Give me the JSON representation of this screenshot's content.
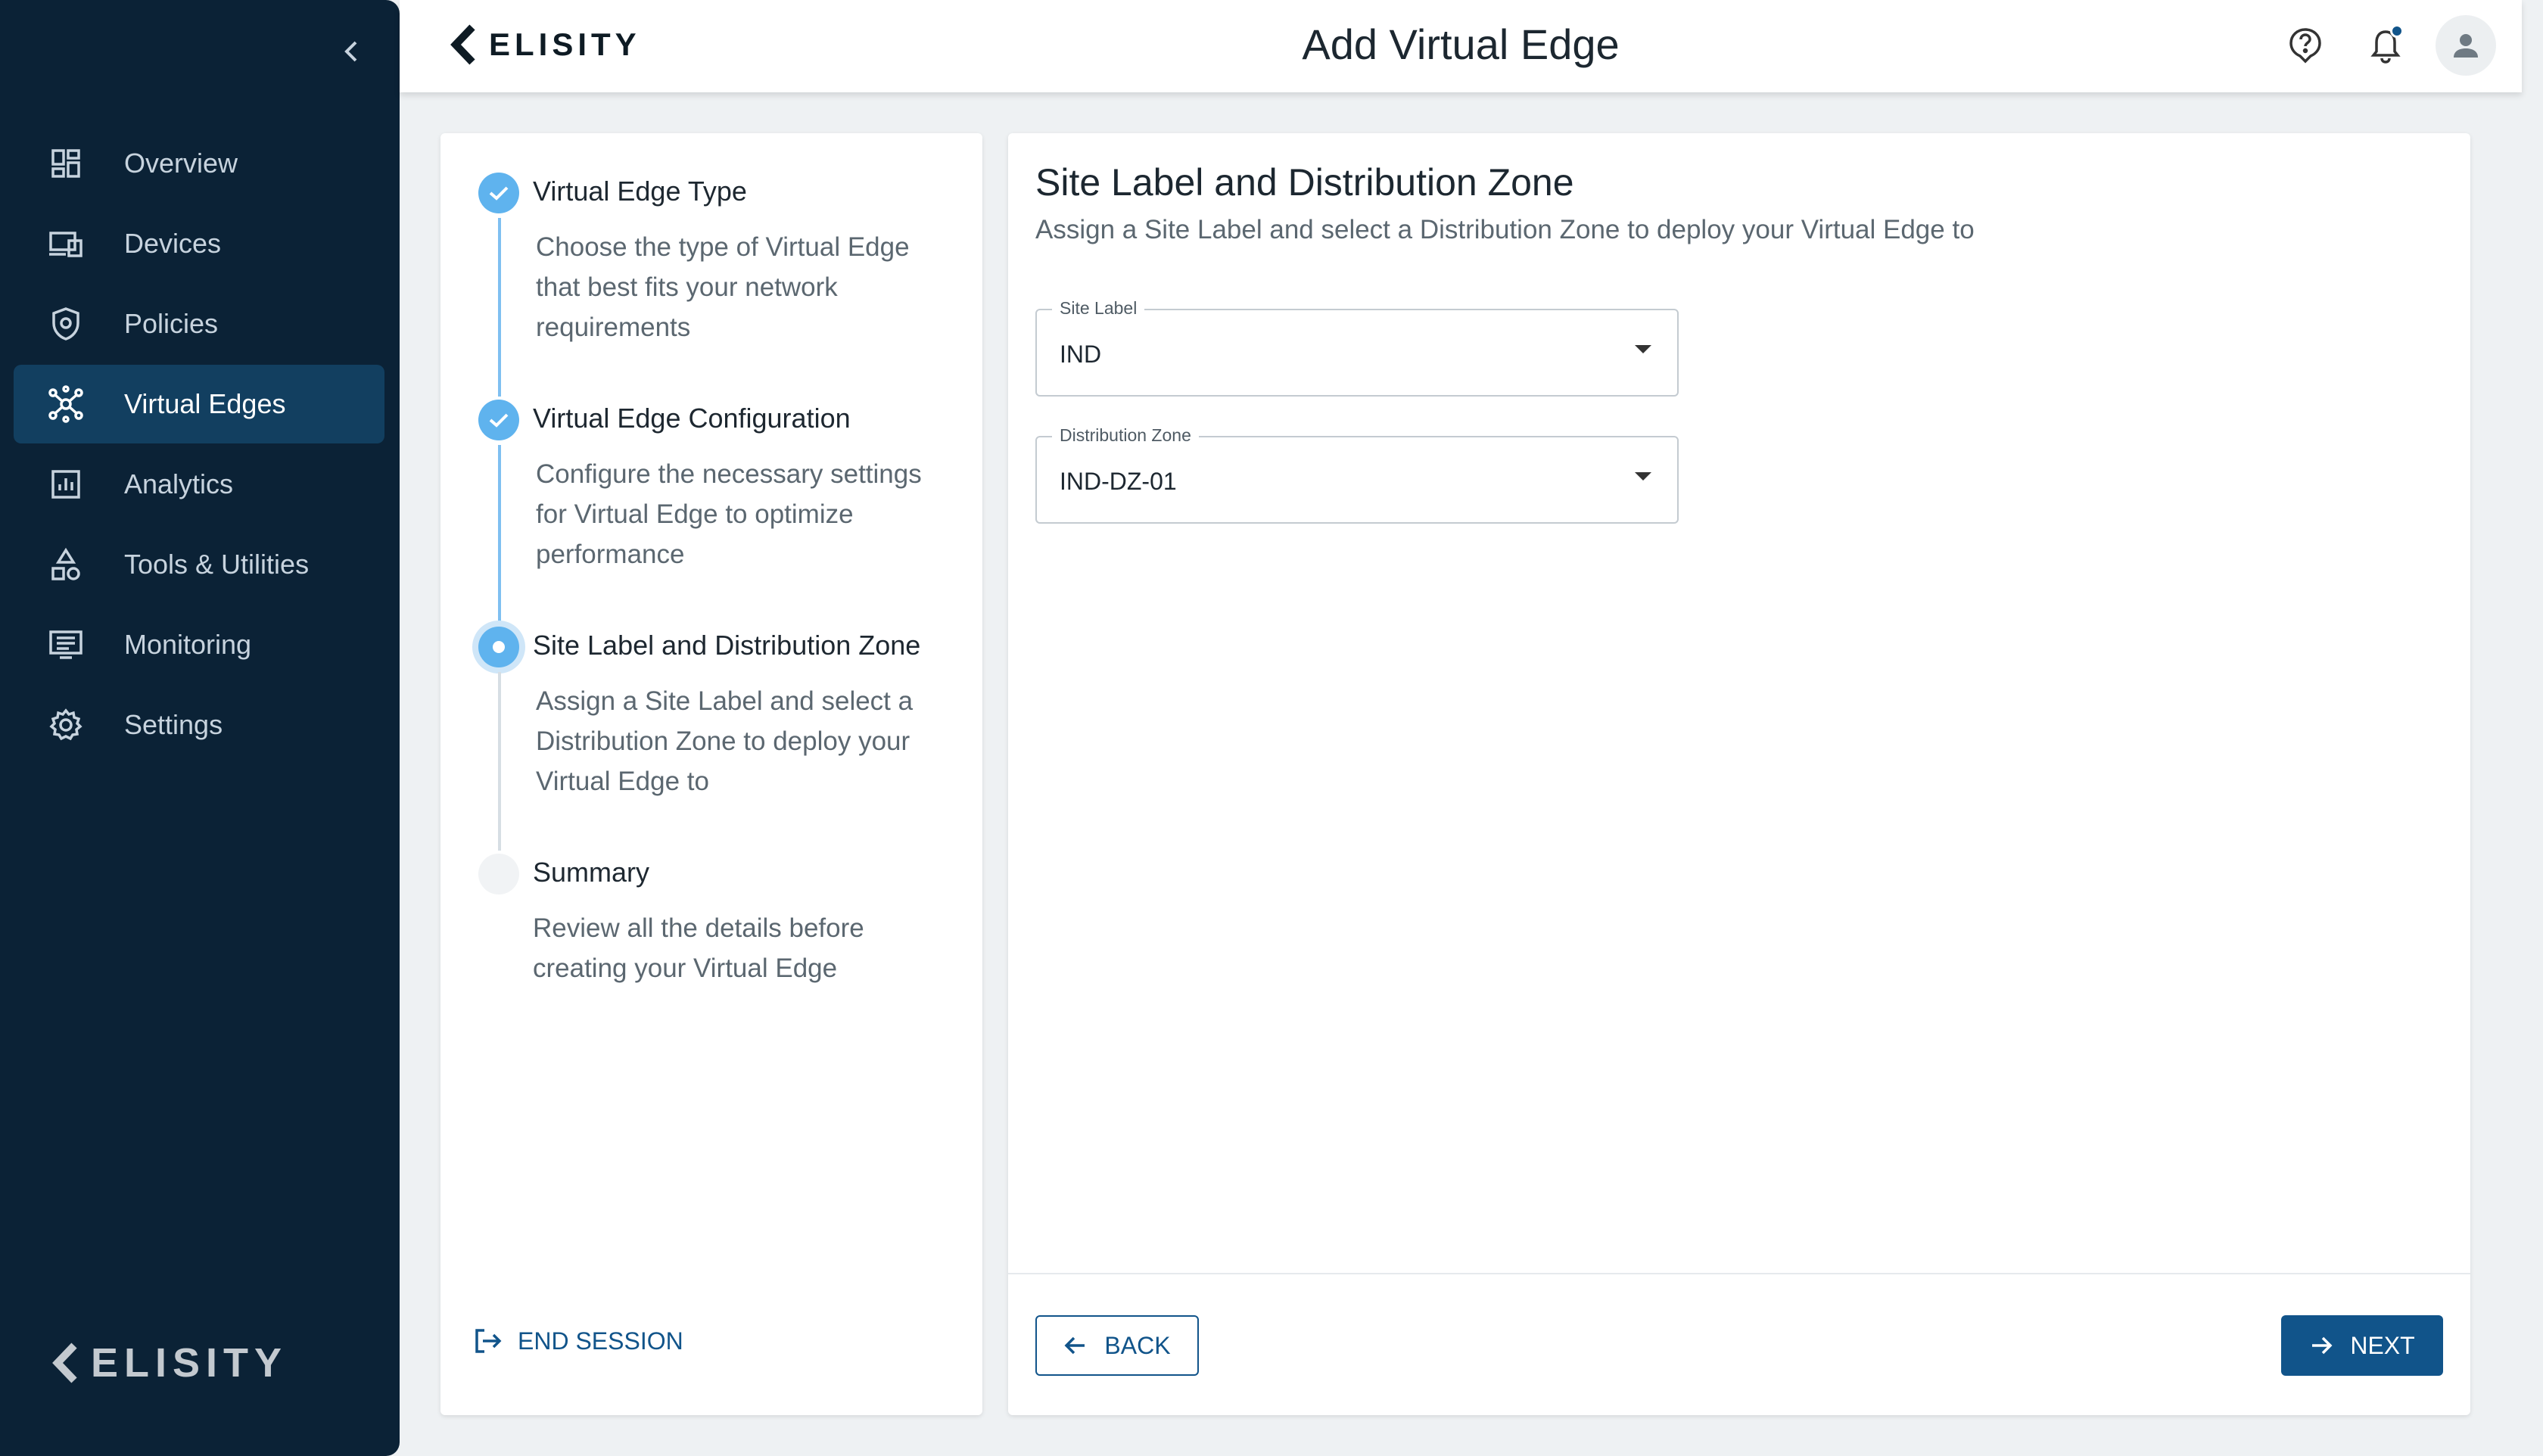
{
  "app": {
    "brand": "ELISITY",
    "page_title": "Add Virtual Edge"
  },
  "sidebar": {
    "items": [
      {
        "label": "Overview",
        "icon": "dashboard-icon"
      },
      {
        "label": "Devices",
        "icon": "devices-icon"
      },
      {
        "label": "Policies",
        "icon": "shield-icon"
      },
      {
        "label": "Virtual Edges",
        "icon": "hub-icon",
        "active": true
      },
      {
        "label": "Analytics",
        "icon": "analytics-icon"
      },
      {
        "label": "Tools & Utilities",
        "icon": "tools-icon"
      },
      {
        "label": "Monitoring",
        "icon": "monitor-icon"
      },
      {
        "label": "Settings",
        "icon": "gear-icon"
      }
    ],
    "footer_brand": "ELISITY"
  },
  "stepper": {
    "steps": [
      {
        "title": "Virtual Edge Type",
        "description": "Choose the type of Virtual Edge that best fits your network requirements",
        "state": "done"
      },
      {
        "title": "Virtual Edge Configuration",
        "description": "Configure the necessary settings for Virtual Edge to optimize performance",
        "state": "done"
      },
      {
        "title": "Site Label and Distribution Zone",
        "description": "Assign a Site Label and select a Distribution Zone to deploy your Virtual Edge to",
        "state": "current"
      },
      {
        "title": "Summary",
        "description": "Review all the details before creating your Virtual Edge",
        "state": "pending"
      }
    ],
    "end_session": "END SESSION"
  },
  "main": {
    "title": "Site Label and Distribution Zone",
    "subtitle": "Assign a Site Label and select a Distribution Zone to deploy your Virtual Edge to",
    "site_label": {
      "label": "Site Label",
      "value": "IND"
    },
    "distribution_zone": {
      "label": "Distribution Zone",
      "value": "IND-DZ-01"
    },
    "back_label": "BACK",
    "next_label": "NEXT"
  },
  "colors": {
    "sidebar_bg": "#0b2236",
    "sidebar_active": "#123f60",
    "primary": "#11548a",
    "step_done": "#5fb3ee"
  }
}
